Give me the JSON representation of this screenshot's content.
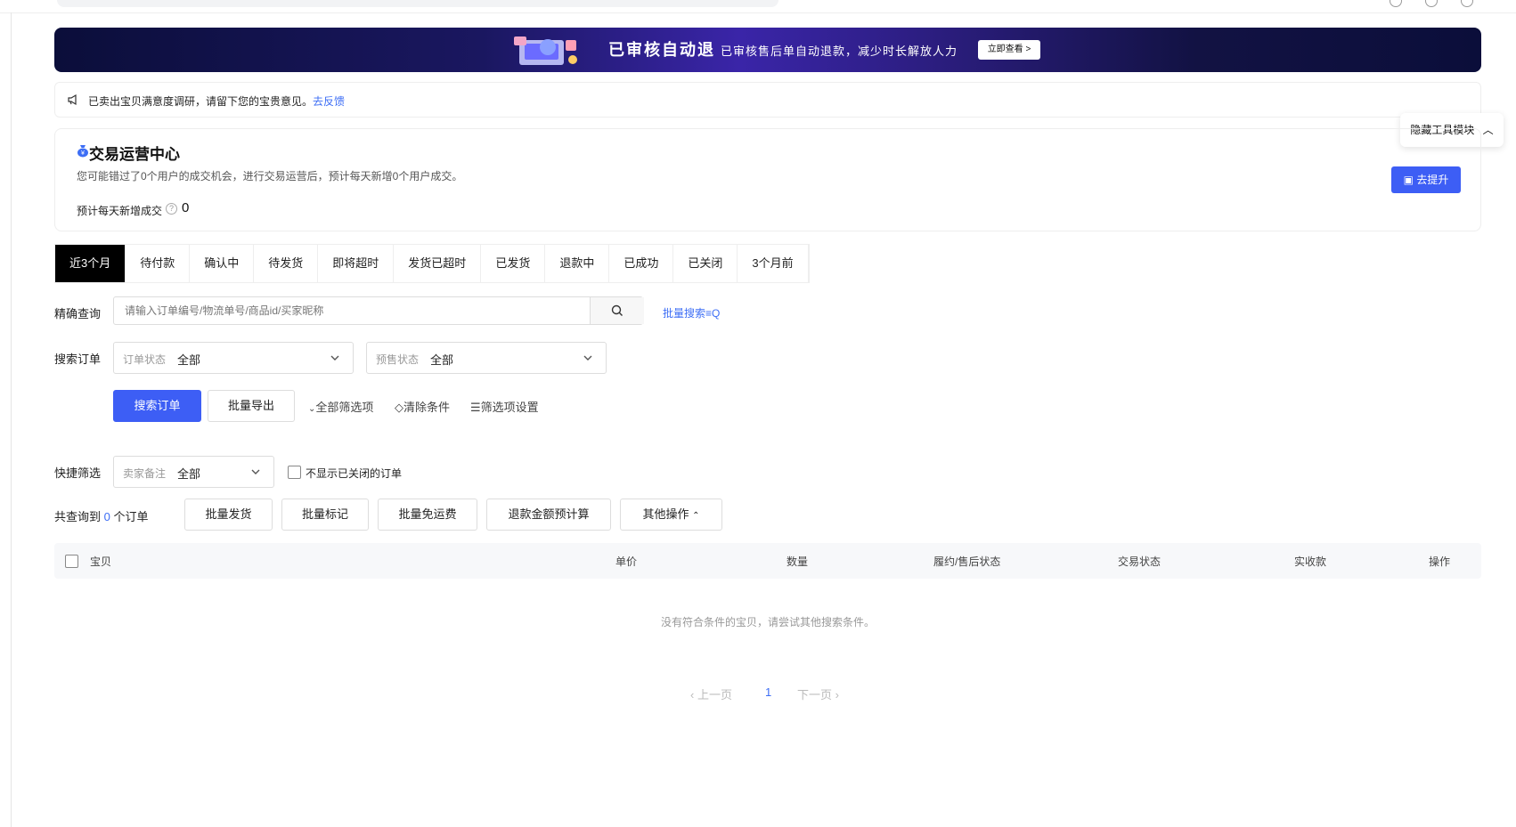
{
  "banner": {
    "title": "已审核自动退",
    "subtitle": "已审核售后单自动退款，减少时长解放人力",
    "button": "立即查看 >"
  },
  "notice": {
    "text": "已卖出宝贝满意度调研，请留下您的宝贵意见。",
    "link": "去反馈"
  },
  "hide_tools": "隐藏工具模块",
  "ops_card": {
    "title": "交易运营中心",
    "desc": "您可能错过了0个用户的成交机会，进行交易运营后，预计每天新增0个用户成交。",
    "metric_label": "预计每天新增成交",
    "metric_value": "0",
    "button": "去提升"
  },
  "tabs": [
    "近3个月",
    "待付款",
    "确认中",
    "待发货",
    "即将超时",
    "发货已超时",
    "已发货",
    "退款中",
    "已成功",
    "已关闭",
    "3个月前"
  ],
  "active_tab": 0,
  "precise": {
    "label": "精确查询",
    "placeholder": "请输入订单编号/物流单号/商品id/买家昵称",
    "batch_search": "批量搜索"
  },
  "search_order": {
    "label": "搜索订单",
    "order_status_key": "订单状态",
    "order_status_value": "全部",
    "presale_key": "预售状态",
    "presale_value": "全部"
  },
  "actions": {
    "search": "搜索订单",
    "export": "批量导出",
    "all_filters": "全部筛选项",
    "clear": "清除条件",
    "filter_settings": "筛选项设置"
  },
  "quick_filter": {
    "label": "快捷筛选",
    "key": "卖家备注",
    "value": "全部",
    "hide_closed": "不显示已关闭的订单"
  },
  "result": {
    "prefix": "共查询到",
    "count": "0",
    "suffix": "个订单",
    "buttons": [
      "批量发货",
      "批量标记",
      "批量免运费",
      "退款金额预计算",
      "其他操作"
    ]
  },
  "table": {
    "columns": [
      "宝贝",
      "单价",
      "数量",
      "履约/售后状态",
      "交易状态",
      "实收款",
      "操作"
    ],
    "empty": "没有符合条件的宝贝，请尝试其他搜索条件。"
  },
  "pager": {
    "prev": "上一页",
    "current": "1",
    "next": "下一页"
  },
  "colors": {
    "primary": "#3d5ef5",
    "link": "#3d6ef5",
    "active_tab_bg": "#000000"
  }
}
